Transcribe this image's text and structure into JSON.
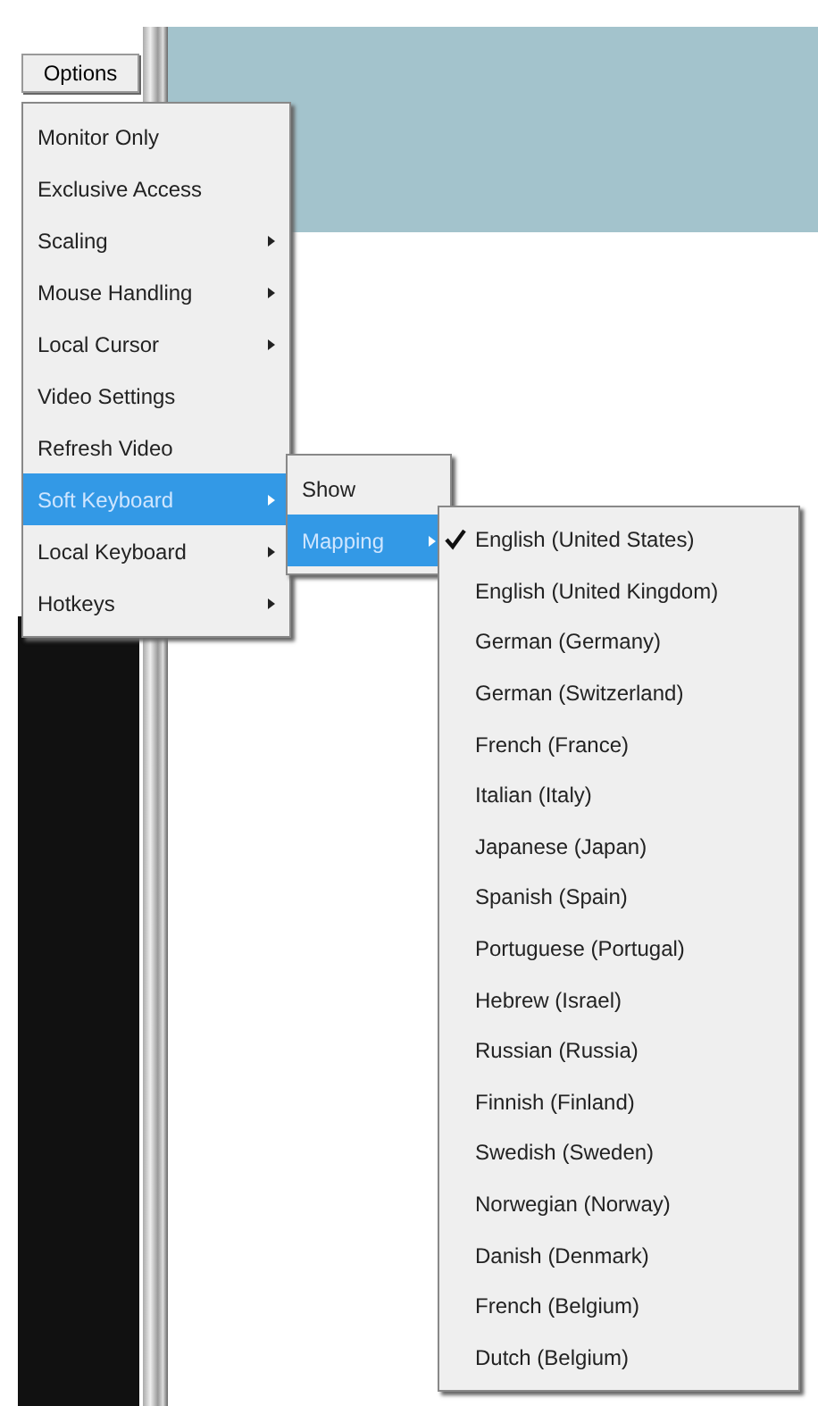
{
  "toolbar": {
    "button": "Options"
  },
  "options_menu": [
    {
      "label": "Monitor Only",
      "submenu": false,
      "selected": false
    },
    {
      "label": "Exclusive Access",
      "submenu": false,
      "selected": false
    },
    {
      "label": "Scaling",
      "submenu": true,
      "selected": false
    },
    {
      "label": "Mouse Handling",
      "submenu": true,
      "selected": false
    },
    {
      "label": "Local Cursor",
      "submenu": true,
      "selected": false
    },
    {
      "label": "Video Settings",
      "submenu": false,
      "selected": false
    },
    {
      "label": "Refresh Video",
      "submenu": false,
      "selected": false
    },
    {
      "label": "Soft Keyboard",
      "submenu": true,
      "selected": true
    },
    {
      "label": "Local Keyboard",
      "submenu": true,
      "selected": false
    },
    {
      "label": "Hotkeys",
      "submenu": true,
      "selected": false
    }
  ],
  "soft_keyboard_menu": [
    {
      "label": "Show",
      "submenu": false,
      "selected": false
    },
    {
      "label": "Mapping",
      "submenu": true,
      "selected": true
    }
  ],
  "mapping_menu": [
    {
      "label": "English (United States)",
      "checked": true
    },
    {
      "label": "English (United Kingdom)",
      "checked": false
    },
    {
      "label": "German (Germany)",
      "checked": false
    },
    {
      "label": "German (Switzerland)",
      "checked": false
    },
    {
      "label": "French (France)",
      "checked": false
    },
    {
      "label": "Italian (Italy)",
      "checked": false
    },
    {
      "label": "Japanese (Japan)",
      "checked": false
    },
    {
      "label": "Spanish (Spain)",
      "checked": false
    },
    {
      "label": "Portuguese (Portugal)",
      "checked": false
    },
    {
      "label": "Hebrew (Israel)",
      "checked": false
    },
    {
      "label": "Russian (Russia)",
      "checked": false
    },
    {
      "label": "Finnish (Finland)",
      "checked": false
    },
    {
      "label": "Swedish (Sweden)",
      "checked": false
    },
    {
      "label": "Norwegian (Norway)",
      "checked": false
    },
    {
      "label": "Danish (Denmark)",
      "checked": false
    },
    {
      "label": "French (Belgium)",
      "checked": false
    },
    {
      "label": "Dutch (Belgium)",
      "checked": false
    }
  ]
}
